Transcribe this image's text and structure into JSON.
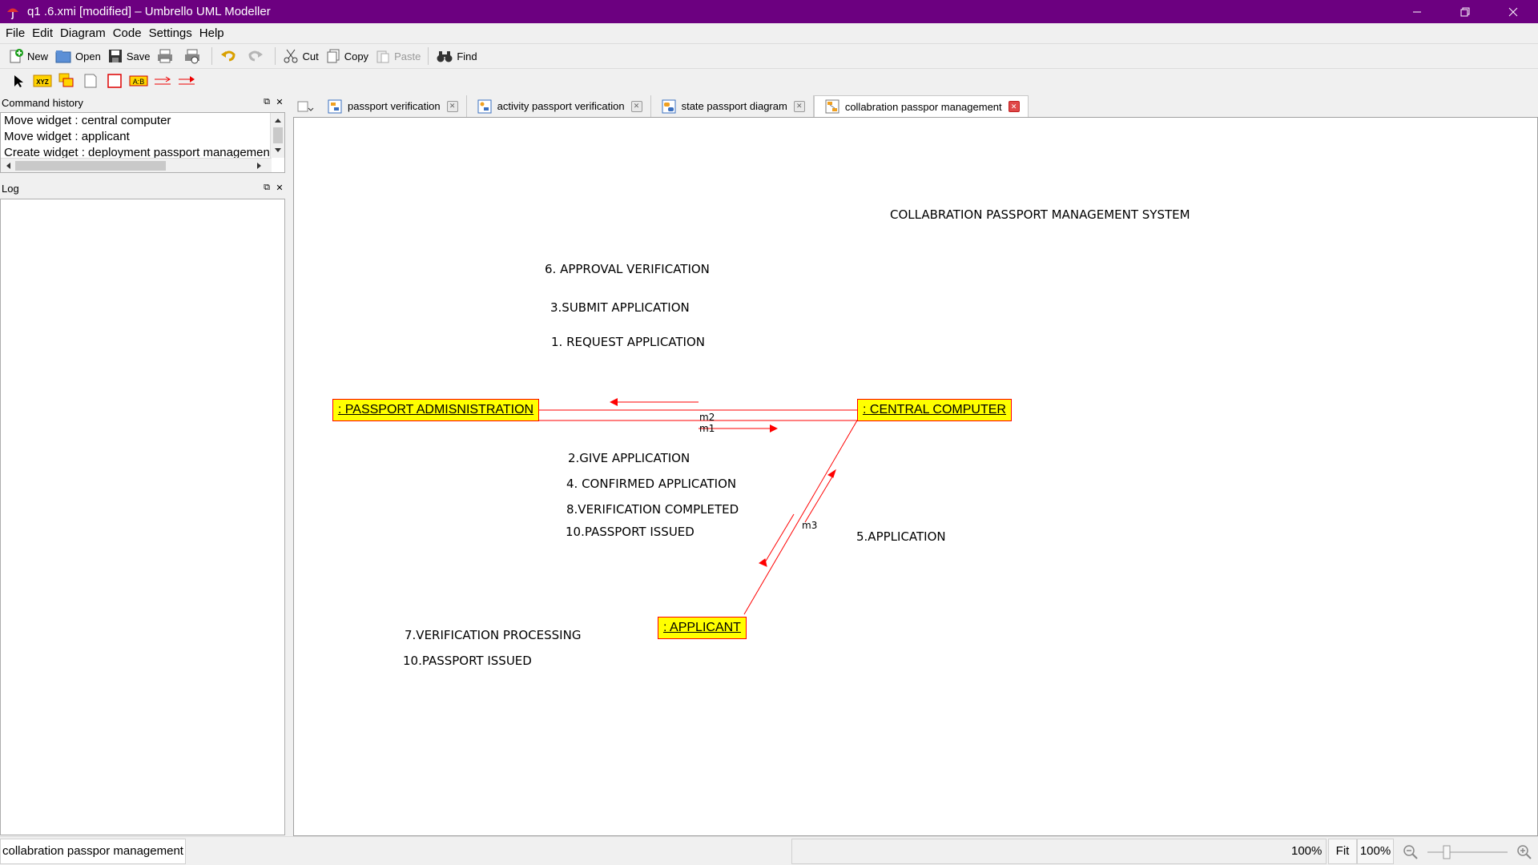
{
  "window": {
    "title": "q1 .6.xmi [modified] – Umbrello UML Modeller"
  },
  "menu": [
    "File",
    "Edit",
    "Diagram",
    "Code",
    "Settings",
    "Help"
  ],
  "toolbar": {
    "new_label": "New",
    "open_label": "Open",
    "save_label": "Save",
    "cut_label": "Cut",
    "copy_label": "Copy",
    "paste_label": "Paste",
    "find_label": "Find"
  },
  "panels": {
    "history_title": "Command history",
    "history_items": [
      "Move widget : central computer",
      "Move widget : applicant",
      "Create widget : deployment passport managemen"
    ],
    "log_title": "Log"
  },
  "tabs": [
    "passport verification",
    "activity passport verification",
    "state passport diagram",
    "collabration passpor management"
  ],
  "diagram": {
    "title": "COLLABRATION PASSPORT MANAGEMENT SYSTEM",
    "objects": {
      "passport_admin": ": PASSPORT ADMISNISTRATION",
      "central_computer": ": CENTRAL COMPUTER",
      "applicant": ": APPLICANT"
    },
    "messages_top": [
      "6. APPROVAL VERIFICATION",
      "3.SUBMIT APPLICATION",
      "1. REQUEST APPLICATION"
    ],
    "messages_middle": [
      "2.GIVE APPLICATION",
      "4. CONFIRMED APPLICATION",
      "8.VERIFICATION COMPLETED",
      "10.PASSPORT ISSUED"
    ],
    "message_right": "5.APPLICATION",
    "messages_bottom": [
      "7.VERIFICATION PROCESSING",
      "10.PASSPORT ISSUED"
    ],
    "link_labels": {
      "m2": "m2",
      "m1": "m1",
      "m3": "m3"
    },
    "link_color": "#ff0000",
    "object_fill": "#ffff00"
  },
  "status": {
    "message": "collabration passpor management",
    "zoom_left": "100%",
    "fit_label": "Fit",
    "zoom_right": "100%"
  }
}
